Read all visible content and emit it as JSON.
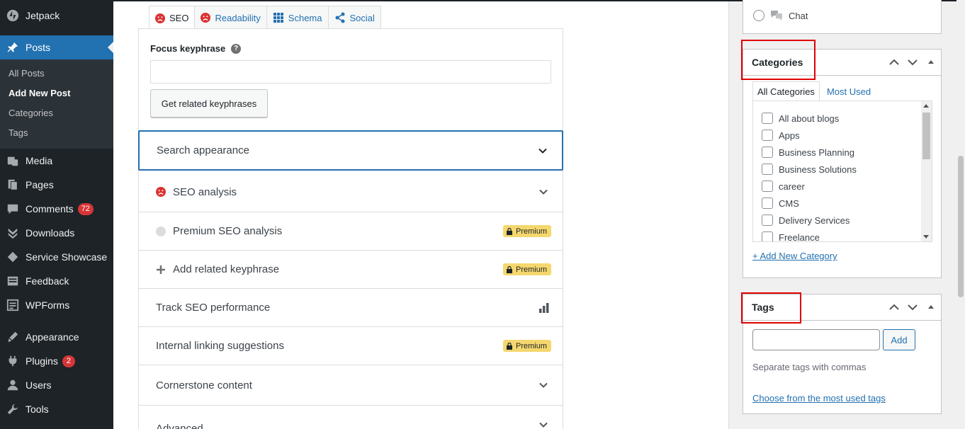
{
  "sidebar": {
    "top_item": {
      "label": "Jetpack",
      "icon": "jetpack-icon"
    },
    "posts": {
      "label": "Posts",
      "icon": "pin-icon"
    },
    "submenu": [
      "All Posts",
      "Add New Post",
      "Categories",
      "Tags"
    ],
    "items": [
      {
        "label": "Media",
        "icon": "media-icon"
      },
      {
        "label": "Pages",
        "icon": "pages-icon"
      },
      {
        "label": "Comments",
        "icon": "comments-icon",
        "badge": "72"
      },
      {
        "label": "Downloads",
        "icon": "downloads-icon"
      },
      {
        "label": "Service Showcase",
        "icon": "showcase-icon"
      },
      {
        "label": "Feedback",
        "icon": "feedback-icon"
      },
      {
        "label": "WPForms",
        "icon": "wpforms-icon"
      },
      {
        "label": "Appearance",
        "icon": "appearance-icon"
      },
      {
        "label": "Plugins",
        "icon": "plugins-icon",
        "badge": "2"
      },
      {
        "label": "Users",
        "icon": "users-icon"
      },
      {
        "label": "Tools",
        "icon": "tools-icon"
      }
    ]
  },
  "yoast": {
    "tabs": [
      {
        "label": "SEO",
        "icon": "sad-face-icon"
      },
      {
        "label": "Readability",
        "icon": "sad-face-icon"
      },
      {
        "label": "Schema",
        "icon": "grid-icon"
      },
      {
        "label": "Social",
        "icon": "share-icon"
      }
    ],
    "focus_label": "Focus keyphrase",
    "focus_value": "",
    "related_button": "Get related keyphrases",
    "premium_label": "Premium",
    "rows": [
      "Search appearance",
      "SEO analysis",
      "Premium SEO analysis",
      "Add related keyphrase",
      "Track SEO performance",
      "Internal linking suggestions",
      "Cornerstone content",
      "Advanced"
    ]
  },
  "format": {
    "chat_label": "Chat"
  },
  "categories": {
    "title": "Categories",
    "tabs": [
      "All Categories",
      "Most Used"
    ],
    "items": [
      "All about blogs",
      "Apps",
      "Business Planning",
      "Business Solutions",
      "career",
      "CMS",
      "Delivery Services",
      "Freelance"
    ],
    "add_new": "+ Add New Category"
  },
  "tags": {
    "title": "Tags",
    "input_value": "",
    "add_label": "Add",
    "hint": "Separate tags with commas",
    "most_used_link": "Choose from the most used tags"
  },
  "colors": {
    "accent": "#2271b1",
    "sidebar": "#1d2327",
    "badge": "#d63638",
    "premium": "#f5d76e",
    "highlight": "#e00000"
  }
}
